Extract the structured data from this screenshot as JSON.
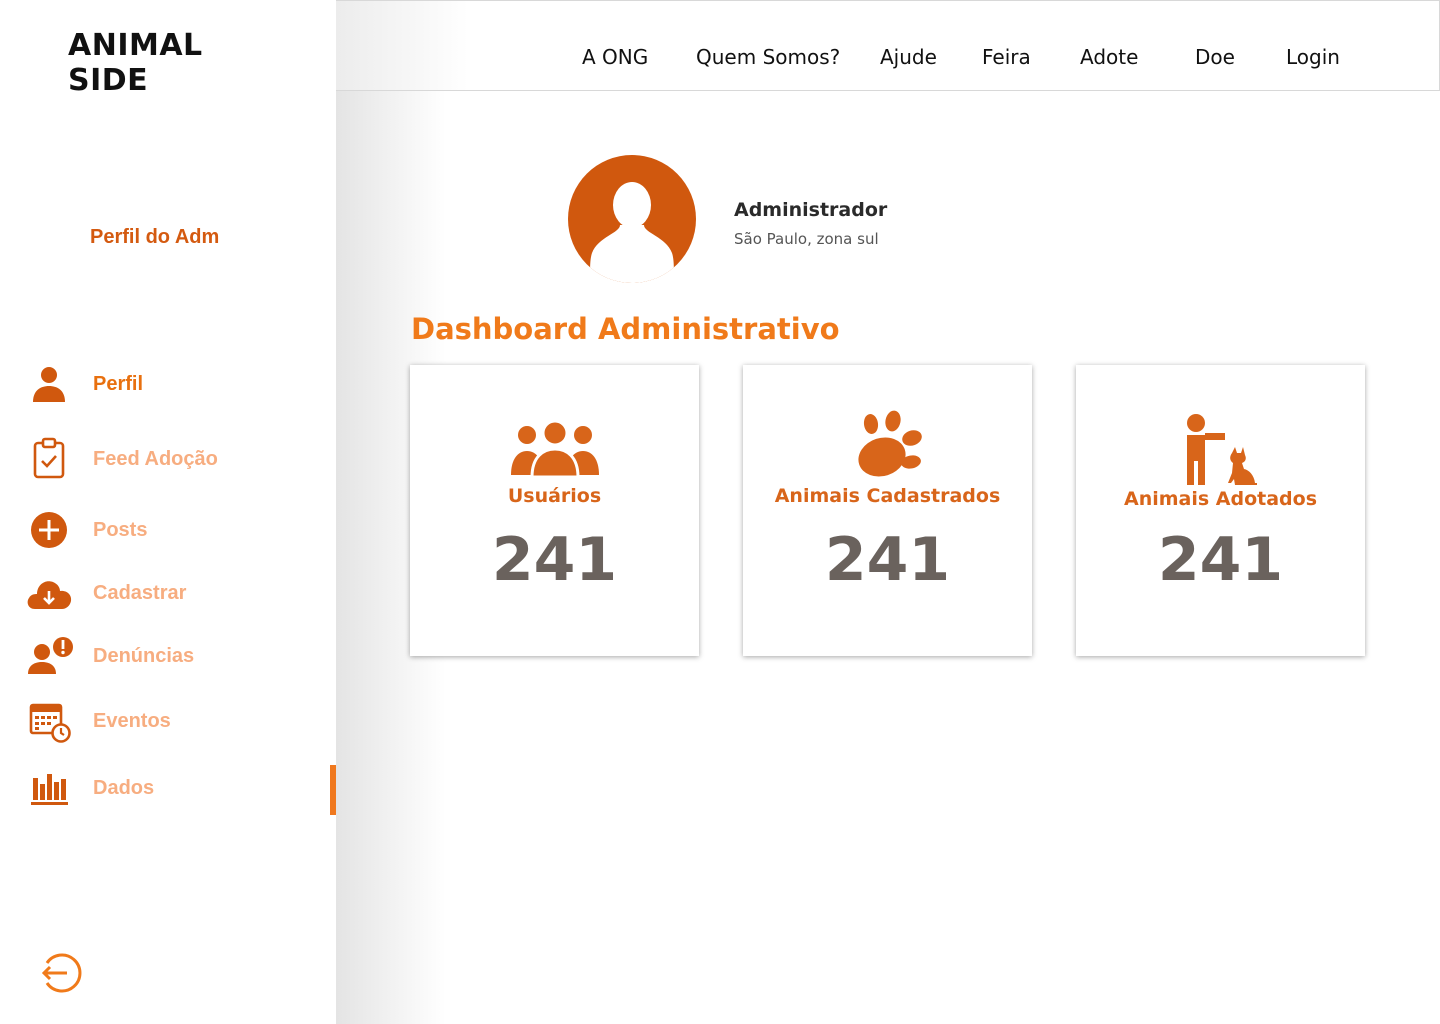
{
  "brand": {
    "logo": "ANIMAL SIDE"
  },
  "sidebar": {
    "profile_label": "Perfil do Adm",
    "items": [
      {
        "label": "Perfil",
        "icon": "user-icon"
      },
      {
        "label": "Feed Adoção",
        "icon": "clipboard-check-icon"
      },
      {
        "label": "Posts",
        "icon": "plus-circle-icon"
      },
      {
        "label": "Cadastrar",
        "icon": "cloud-download-icon"
      },
      {
        "label": "Denúncias",
        "icon": "user-alert-icon"
      },
      {
        "label": "Eventos",
        "icon": "calendar-clock-icon"
      },
      {
        "label": "Dados",
        "icon": "bar-chart-icon"
      }
    ],
    "logout_icon": "logout-icon"
  },
  "topnav": {
    "items": [
      "A ONG",
      "Quem Somos?",
      "Ajude",
      "Feira",
      "Adote",
      "Doe",
      "Login"
    ]
  },
  "admin": {
    "name": "Administrador",
    "location": "São Paulo, zona sul"
  },
  "dashboard": {
    "title": "Dashboard Administrativo",
    "cards": [
      {
        "label": "Usuários",
        "value": "241",
        "icon": "users-group-icon"
      },
      {
        "label": "Animais Cadastrados",
        "value": "241",
        "icon": "paw-icon"
      },
      {
        "label": "Animais Adotados",
        "value": "241",
        "icon": "person-dog-icon"
      }
    ]
  },
  "colors": {
    "accent": "#f07a1a",
    "accent_dark": "#d0580e",
    "inactive_label": "#f7ad80",
    "value_text": "#6a625d"
  }
}
